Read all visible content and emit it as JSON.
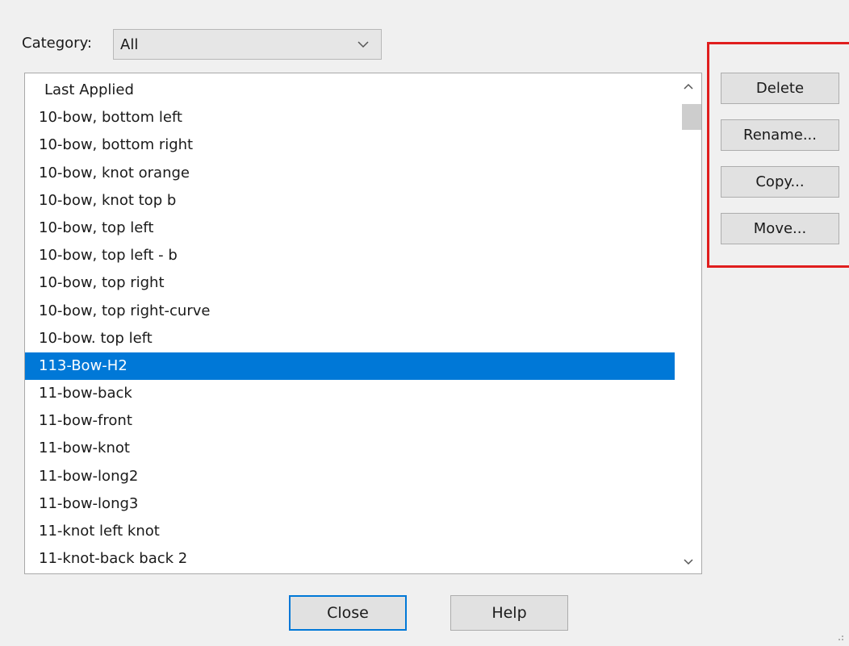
{
  "category": {
    "label": "Category:",
    "value": "All"
  },
  "list": {
    "items": [
      "Last Applied",
      "10-bow, bottom left",
      "10-bow, bottom right",
      "10-bow, knot orange",
      "10-bow, knot top b",
      "10-bow, top left",
      "10-bow, top left - b",
      "10-bow, top right",
      "10-bow, top right-curve",
      "10-bow. top left",
      "113-Bow-H2",
      "11-bow-back",
      "11-bow-front",
      "11-bow-knot",
      "11-bow-long2",
      "11-bow-long3",
      "11-knot left knot",
      "11-knot-back back 2"
    ],
    "selected_index": 10,
    "selection_color": "#0078d7"
  },
  "actions": {
    "delete_label": "Delete",
    "rename_label": "Rename...",
    "copy_label": "Copy...",
    "move_label": "Move...",
    "highlight_color": "#e01e1e"
  },
  "footer": {
    "close_label": "Close",
    "help_label": "Help"
  },
  "icons": {
    "dropdown": "chevron-down-icon",
    "scroll_up": "chevron-up-icon",
    "scroll_down": "chevron-down-icon",
    "grip": "resize-grip-icon"
  }
}
